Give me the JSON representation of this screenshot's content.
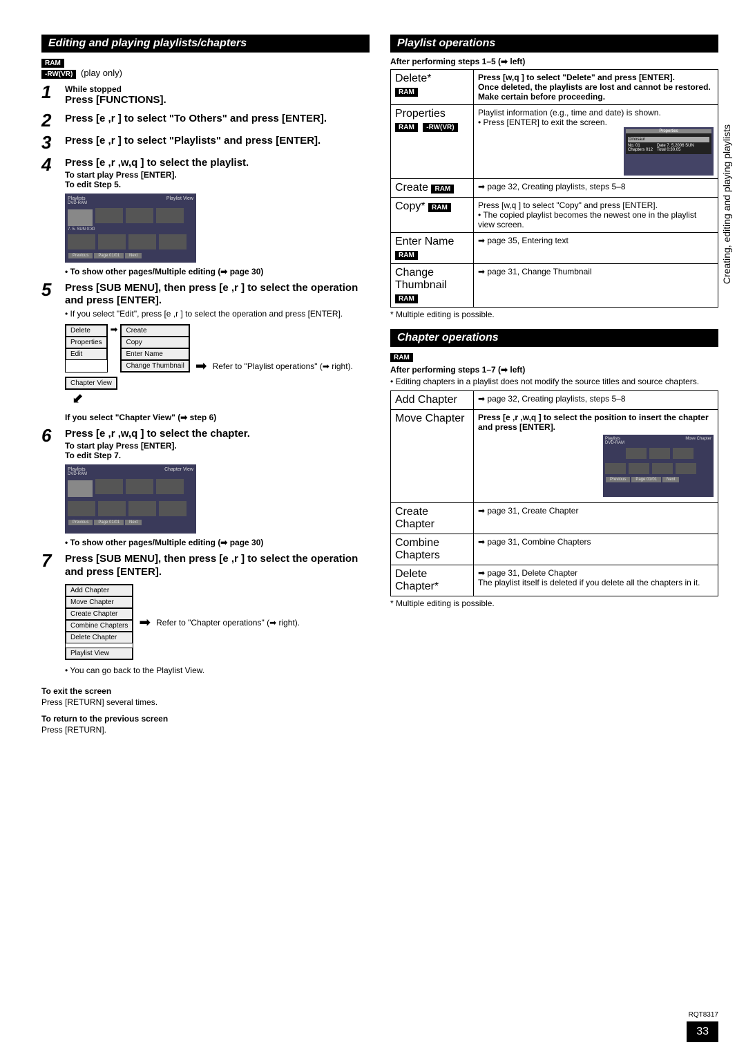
{
  "side_label": "Creating, editing and playing playlists",
  "doc_id": "RQT8317",
  "page_num": "33",
  "left": {
    "header": "Editing and playing playlists/chapters",
    "badge_ram": "RAM",
    "badge_rwvr": "-RW(VR)",
    "play_only": "(play only)",
    "steps": [
      {
        "num": "1",
        "pre": "While stopped",
        "main": "Press [FUNCTIONS]."
      },
      {
        "num": "2",
        "main": "Press [e ,r ] to select \"To Others\" and press [ENTER]."
      },
      {
        "num": "3",
        "main": "Press [e ,r ] to select \"Playlists\" and press [ENTER]."
      },
      {
        "num": "4",
        "main": "Press [e ,r ,w,q ] to select the playlist.",
        "sub1": "To start play    Press [ENTER].",
        "sub2": "To edit    Step 5.",
        "note": "• To show other pages/Multiple editing (➡ page 30)"
      },
      {
        "num": "5",
        "main": "Press [SUB MENU], then press [e ,r ] to select the operation and press [ENTER].",
        "sub3": "• If you select \"Edit\", press [e ,r ] to select the operation and press [ENTER].",
        "menu_left": [
          "Delete",
          "Properties",
          "Edit"
        ],
        "menu_right": [
          "Create",
          "Copy",
          "Enter Name",
          "Change Thumbnail"
        ],
        "menu_bottom": "Chapter View",
        "menu_note": "Refer to \"Playlist operations\" (➡ right).",
        "after_note": "If you select \"Chapter View\" (➡ step 6)"
      },
      {
        "num": "6",
        "main": "Press [e ,r ,w,q ] to select the chapter.",
        "sub1": "To start play    Press [ENTER].",
        "sub2": "To edit    Step 7.",
        "note": "• To show other pages/Multiple editing (➡ page 30)"
      },
      {
        "num": "7",
        "main": "Press [SUB MENU], then press [e ,r ] to select the operation and press [ENTER].",
        "menu_col": [
          "Add Chapter",
          "Move Chapter",
          "Create Chapter",
          "Combine Chapters",
          "Delete Chapter",
          "Playlist View"
        ],
        "menu_note": "Refer to \"Chapter operations\" (➡ right).",
        "after_note": "• You can go back to the Playlist View."
      }
    ],
    "exit_h": "To exit the screen",
    "exit_t": "Press [RETURN] several times.",
    "return_h": "To return to the previous screen",
    "return_t": "Press [RETURN].",
    "shot1": {
      "title": "Playlists",
      "sub": "Playlist View",
      "media": "DVD-RAM",
      "time": "7. 5. SUN 0:30",
      "prev": "Previous",
      "page": "Page   01/01",
      "next": "Next"
    },
    "shot2": {
      "title": "Playlists",
      "sub": "Chapter View",
      "media": "DVD-RAM",
      "prev": "Previous",
      "page": "Page   01/01",
      "next": "Next"
    }
  },
  "right": {
    "header1": "Playlist operations",
    "pre1": "After performing steps 1–5 (➡ left)",
    "rows1": [
      {
        "label": "Delete*",
        "badges": [
          "RAM"
        ],
        "body": "Press [w,q ] to select \"Delete\" and press [ENTER].\nOnce deleted, the playlists are lost and cannot be restored.\nMake certain before proceeding.",
        "bold": true
      },
      {
        "label": "Properties",
        "badges": [
          "RAM",
          "-RW(VR)"
        ],
        "body": "Playlist information (e.g., time and date) is shown.\n• Press [ENTER] to exit the screen.",
        "shot": true,
        "prop_shot": {
          "title": "Properties",
          "name": "Dinosaur",
          "no": "No.",
          "no_v": "01",
          "ch": "Chapters",
          "ch_v": "012",
          "date": "Date 7. 5.2006 SUN",
          "total": "Total 0:30.05"
        }
      },
      {
        "label": "Create",
        "badges": [
          "RAM"
        ],
        "body": "➡ page 32, Creating playlists, steps 5–8"
      },
      {
        "label": "Copy*",
        "badges": [
          "RAM"
        ],
        "body": "Press [w,q ] to select \"Copy\" and press [ENTER].\n• The copied playlist becomes the newest one in the playlist view screen.",
        "bold": true
      },
      {
        "label": "Enter Name",
        "badges": [
          "RAM"
        ],
        "body": "➡ page 35, Entering text"
      },
      {
        "label": "Change Thumbnail",
        "badges": [
          "RAM"
        ],
        "body": "➡ page 31, Change Thumbnail"
      }
    ],
    "foot1": "* Multiple editing is possible.",
    "header2": "Chapter operations",
    "badge2": "RAM",
    "pre2": "After performing steps 1–7 (➡ left)",
    "pre2b": "• Editing chapters in a playlist does not modify the source titles and source chapters.",
    "rows2": [
      {
        "label": "Add Chapter",
        "body": "➡ page 32, Creating playlists, steps 5–8"
      },
      {
        "label": "Move Chapter",
        "body": "Press [e ,r ,w,q ] to select the position to insert the chapter and press [ENTER].",
        "bold": true,
        "shot": true,
        "move_shot": {
          "title": "Playlists",
          "sub": "Move Chapter",
          "media": "DVD-RAM",
          "prev": "Previous",
          "page": "Page   01/01",
          "next": "Next"
        }
      },
      {
        "label": "Create Chapter",
        "body": "➡ page 31, Create Chapter"
      },
      {
        "label": "Combine Chapters",
        "body": "➡ page 31, Combine Chapters"
      },
      {
        "label": "Delete Chapter*",
        "body": "➡ page 31, Delete Chapter\nThe playlist itself is deleted if you delete all the chapters in it."
      }
    ],
    "foot2": "* Multiple editing is possible."
  }
}
